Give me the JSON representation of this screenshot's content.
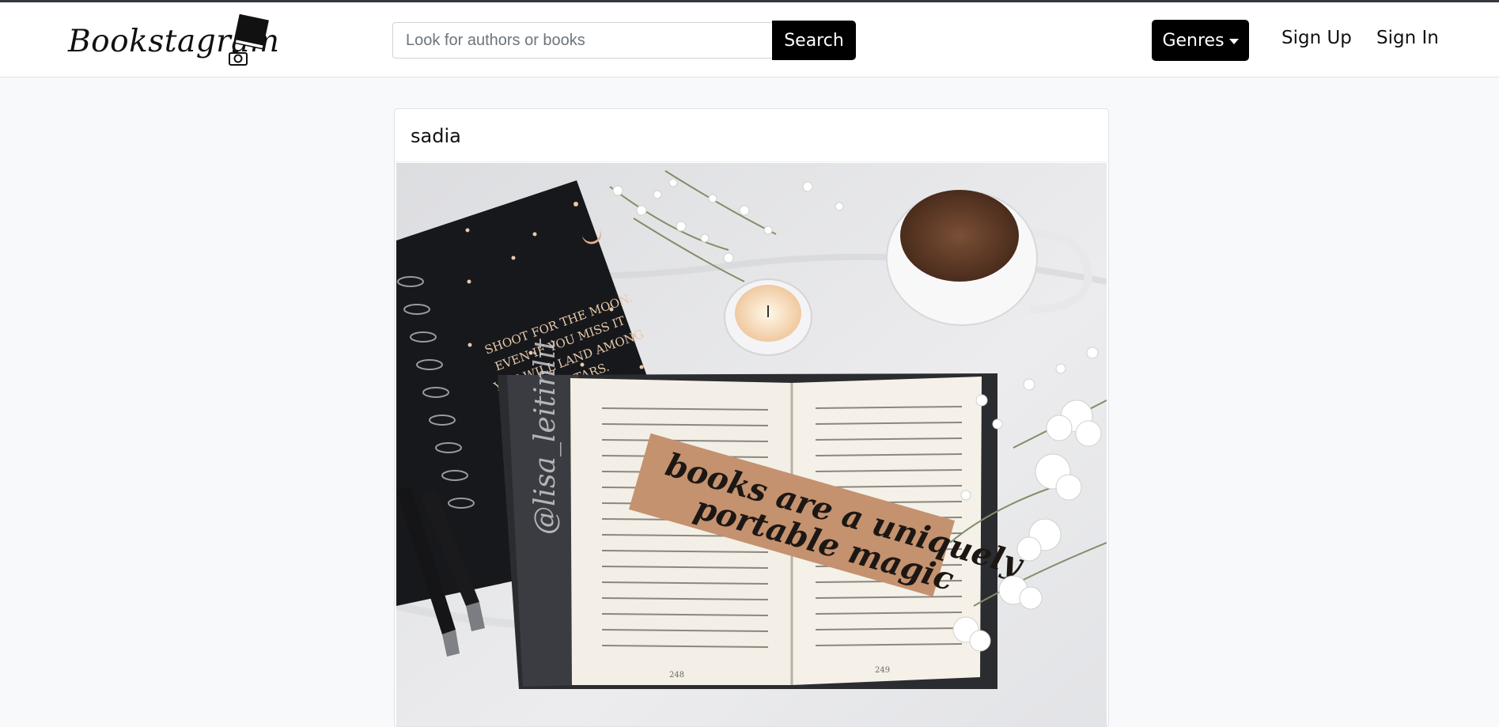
{
  "navbar": {
    "brand": "Bookstagram",
    "search_placeholder": "Look for authors or books",
    "search_label": "Search",
    "genres_label": "Genres",
    "signup_label": "Sign Up",
    "signin_label": "Sign In"
  },
  "post": {
    "username": "sadia",
    "notebook_quote": [
      "SHOOT FOR THE MOON.",
      "EVEN IF YOU MISS IT",
      "YOU WILL LAND AMONG",
      "THE STARS."
    ],
    "bookmark_lines": [
      "books are a uniquely",
      "portable magic"
    ],
    "watermark": "@lisa_leitinlit",
    "page_numbers": [
      "248",
      "249"
    ]
  },
  "colors": {
    "button_bg": "#000000",
    "page_bg": "#f8f9fa",
    "topline": "#343a40"
  }
}
